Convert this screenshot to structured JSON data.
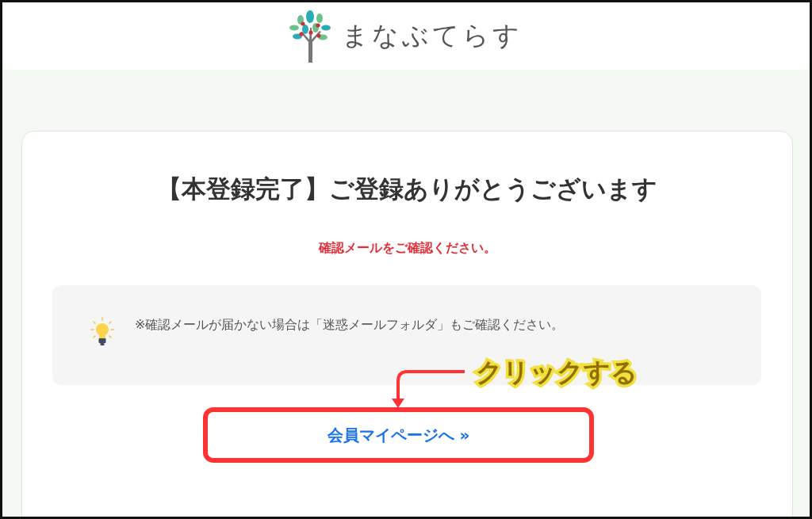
{
  "logo": {
    "text": "まなぶてらす"
  },
  "title": "【本登録完了】ご登録ありがとうございます",
  "notice": "確認メールをご確認ください。",
  "tip": {
    "text": "※確認メールが届かない場合は「迷惑メールフォルダ」もご確認ください。"
  },
  "button": {
    "label": "会員マイページへ »"
  },
  "annotation": {
    "text": "クリックする"
  }
}
